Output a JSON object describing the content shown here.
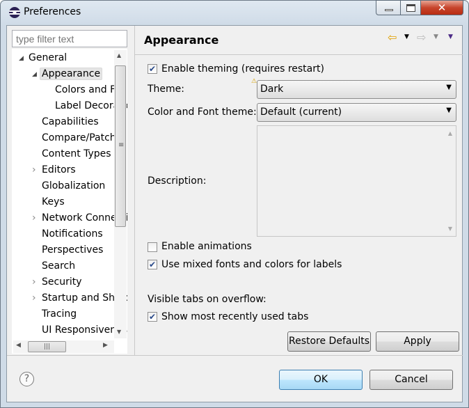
{
  "window": {
    "title": "Preferences",
    "minimize": "minimize",
    "maximize": "maximize",
    "close": "close"
  },
  "filter": {
    "placeholder": "type filter text"
  },
  "tree": {
    "items": [
      {
        "label": "General",
        "level": 0,
        "expander": "expanded"
      },
      {
        "label": "Appearance",
        "level": 1,
        "expander": "expanded",
        "selected": true
      },
      {
        "label": "Colors and Fonts",
        "level": 2,
        "expander": "none"
      },
      {
        "label": "Label Decorations",
        "level": 2,
        "expander": "none"
      },
      {
        "label": "Capabilities",
        "level": 1,
        "expander": "none"
      },
      {
        "label": "Compare/Patch",
        "level": 1,
        "expander": "none"
      },
      {
        "label": "Content Types",
        "level": 1,
        "expander": "none"
      },
      {
        "label": "Editors",
        "level": 1,
        "expander": "collapsed"
      },
      {
        "label": "Globalization",
        "level": 1,
        "expander": "none"
      },
      {
        "label": "Keys",
        "level": 1,
        "expander": "none"
      },
      {
        "label": "Network Connections",
        "level": 1,
        "expander": "collapsed"
      },
      {
        "label": "Notifications",
        "level": 1,
        "expander": "none"
      },
      {
        "label": "Perspectives",
        "level": 1,
        "expander": "none"
      },
      {
        "label": "Search",
        "level": 1,
        "expander": "none"
      },
      {
        "label": "Security",
        "level": 1,
        "expander": "collapsed"
      },
      {
        "label": "Startup and Shutdown",
        "level": 1,
        "expander": "collapsed"
      },
      {
        "label": "Tracing",
        "level": 1,
        "expander": "none"
      },
      {
        "label": "UI Responsiveness",
        "level": 1,
        "expander": "none"
      }
    ]
  },
  "page": {
    "title": "Appearance",
    "enable_theming": {
      "label": "Enable theming (requires restart)",
      "checked": true
    },
    "theme": {
      "label": "Theme:",
      "value": "Dark"
    },
    "color_font_theme": {
      "label": "Color and Font theme:",
      "value": "Default (current)"
    },
    "description": {
      "label": "Description:",
      "value": ""
    },
    "enable_animations": {
      "label": "Enable animations",
      "checked": false
    },
    "mixed_fonts": {
      "label": "Use mixed fonts and colors for labels",
      "checked": true
    },
    "visible_tabs_label": "Visible tabs on overflow:",
    "show_mru": {
      "label": "Show most recently used tabs",
      "checked": true
    },
    "restore_defaults": "Restore Defaults",
    "apply": "Apply"
  },
  "footer": {
    "ok": "OK",
    "cancel": "Cancel"
  },
  "colors": {
    "accent": "#3399ff",
    "selection": "#e5e5e5",
    "back_arrow": "#e0a000",
    "menu_arrow": "#4b2a86"
  }
}
